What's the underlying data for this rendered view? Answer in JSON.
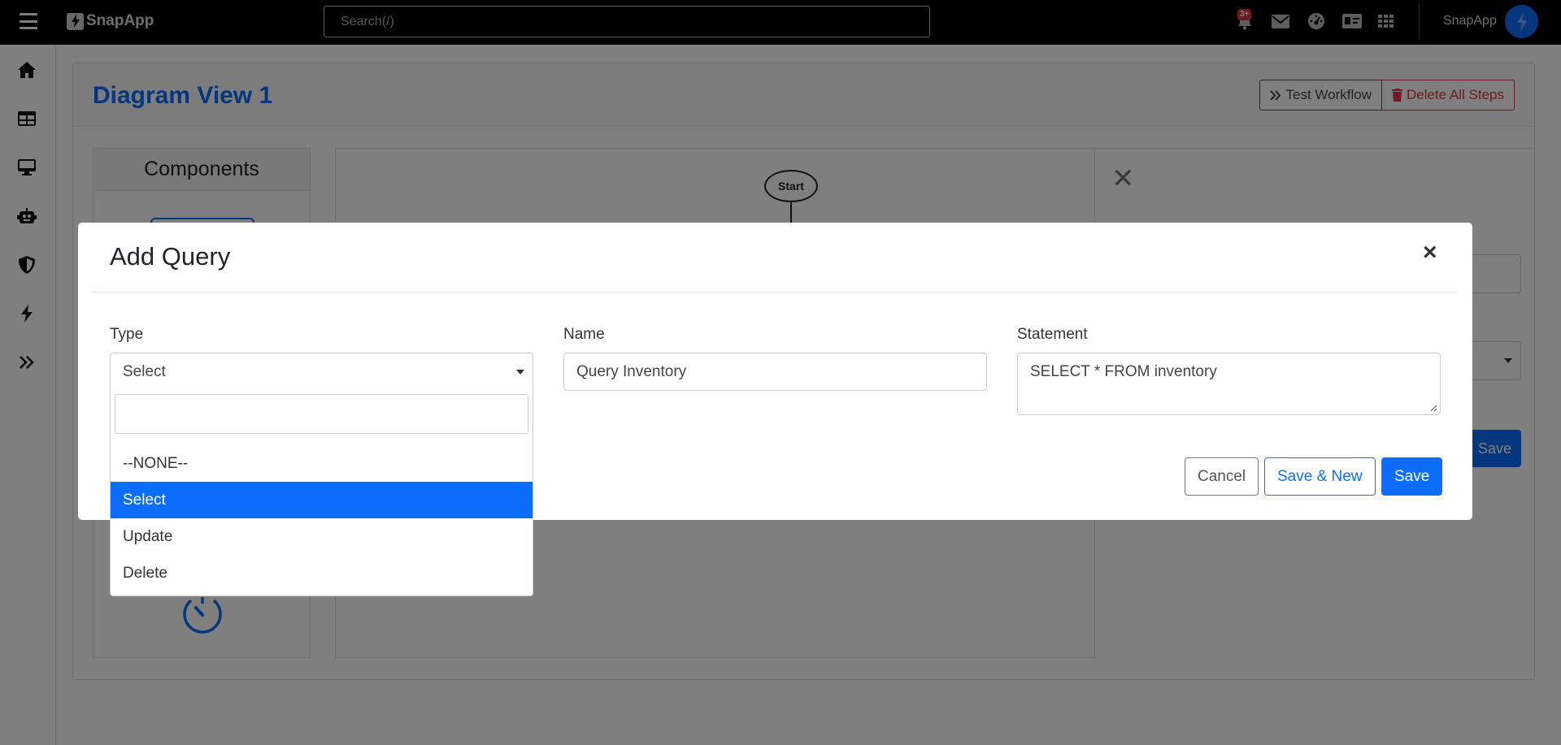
{
  "topbar": {
    "brand": "SnapApp",
    "search_placeholder": "Search(/)",
    "notification_badge": "3+",
    "user_name": "SnapApp"
  },
  "page": {
    "title": "Diagram View 1",
    "test_workflow_label": "Test Workflow",
    "delete_all_label": "Delete All Steps",
    "components_header": "Components",
    "start_node_label": "Start",
    "props_save_label": "Save"
  },
  "modal": {
    "title": "Add Query",
    "type_label": "Type",
    "type_value": "Select",
    "name_label": "Name",
    "name_value": "Query Inventory",
    "statement_label": "Statement",
    "statement_value": "SELECT * FROM inventory",
    "cancel_label": "Cancel",
    "save_new_label": "Save & New",
    "save_label": "Save"
  },
  "dropdown": {
    "options": [
      "--NONE--",
      "Select",
      "Update",
      "Delete"
    ],
    "selected": "Select"
  },
  "icons": {
    "accent": "#0d6efd",
    "danger": "#dc3545"
  }
}
